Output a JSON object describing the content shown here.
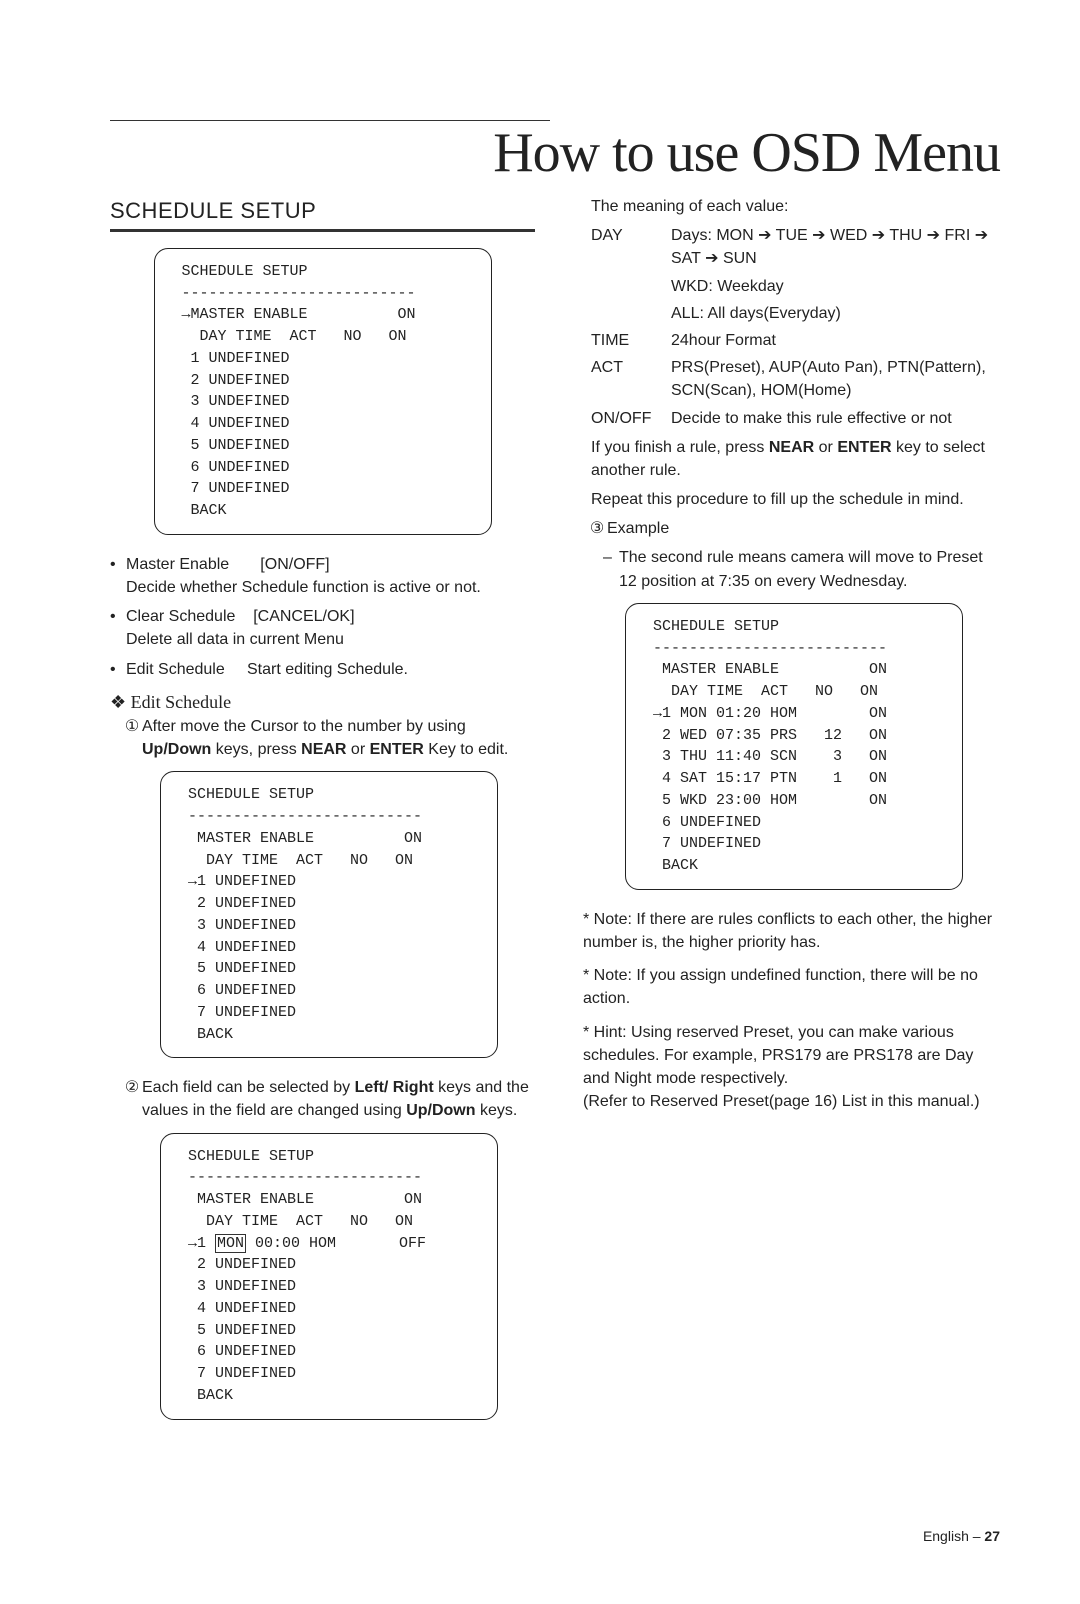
{
  "title": "How to use OSD Menu",
  "section_head": "SCHEDULE SETUP",
  "osd1": " SCHEDULE SETUP\n --------------------------\n →MASTER ENABLE          ON\n   DAY TIME  ACT   NO   ON\n  1 UNDEFINED\n  2 UNDEFINED\n  3 UNDEFINED\n  4 UNDEFINED\n  5 UNDEFINED\n  6 UNDEFINED\n  7 UNDEFINED\n  BACK",
  "b1_label": "Master Enable",
  "b1_opt": "[ON/OFF]",
  "b1_desc": "Decide whether Schedule function is active or not.",
  "b2_label": "Clear Schedule",
  "b2_opt": "[CANCEL/OK]",
  "b2_desc": "Delete all data in current Menu",
  "b3_label": "Edit Schedule",
  "b3_desc": "Start editing Schedule.",
  "edit_head": "❖ Edit Schedule",
  "step1_num": "①",
  "step1_a": "After move the Cursor to the number by using ",
  "step1_b": "Up/Down",
  "step1_c": " keys, press ",
  "step1_d": "NEAR",
  "step1_e": " or ",
  "step1_f": "ENTER",
  "step1_g": " Key to edit.",
  "osd2": " SCHEDULE SETUP\n --------------------------\n  MASTER ENABLE          ON\n   DAY TIME  ACT   NO   ON\n →1 UNDEFINED\n  2 UNDEFINED\n  3 UNDEFINED\n  4 UNDEFINED\n  5 UNDEFINED\n  6 UNDEFINED\n  7 UNDEFINED\n  BACK",
  "step2_num": "②",
  "step2_a": "Each field can be selected by ",
  "step2_b": "Left/ Right",
  "step2_c": " keys and the values in the field are changed using ",
  "step2_d": "Up/Down",
  "step2_e": " keys.",
  "osd3": " SCHEDULE SETUP\n --------------------------\n  MASTER ENABLE          ON\n   DAY TIME  ACT   NO   ON\n →1 MON 00:00 HOM       OFF\n  2 UNDEFINED\n  3 UNDEFINED\n  4 UNDEFINED\n  5 UNDEFINED\n  6 UNDEFINED\n  7 UNDEFINED\n  BACK",
  "right_intro": "The meaning of each value:",
  "kv_day_k": "DAY",
  "kv_day_v1": "Days: MON ➔ TUE ➔ WED ➔ THU ➔ FRI ➔ SAT ➔ SUN",
  "kv_day_v2": "WKD: Weekday",
  "kv_day_v3": "ALL: All days(Everyday)",
  "kv_time_k": "TIME",
  "kv_time_v": "24hour Format",
  "kv_act_k": "ACT",
  "kv_act_v": "PRS(Preset), AUP(Auto Pan), PTN(Pattern), SCN(Scan), HOM(Home)",
  "kv_onoff_k": "ON/OFF",
  "kv_onoff_v": "Decide to make this rule effective or not",
  "finish_a": "If you finish a rule, press ",
  "finish_b": "NEAR",
  "finish_c": " or ",
  "finish_d": "ENTER",
  "finish_e": " key to select another rule.",
  "repeat": "Repeat this procedure to fill up the schedule in mind.",
  "step3_num": "③",
  "step3_label": "Example",
  "example_desc": "The second rule means camera will move to Preset 12 position at 7:35 on every Wednesday.",
  "osd4": " SCHEDULE SETUP\n --------------------------\n  MASTER ENABLE          ON\n   DAY TIME  ACT   NO   ON\n →1 MON 01:20 HOM        ON\n  2 WED 07:35 PRS   12   ON\n  3 THU 11:40 SCN    3   ON\n  4 SAT 15:17 PTN    1   ON\n  5 WKD 23:00 HOM        ON\n  6 UNDEFINED\n  7 UNDEFINED\n  BACK",
  "note1": "* Note: If there are rules conflicts to each other, the higher number is, the higher priority has.",
  "note2": "* Note: If you assign undefined function, there will be no action.",
  "note3": "* Hint: Using reserved Preset, you can make various schedules. For example, PRS179 are PRS178 are Day and Night mode respectively.",
  "note3b": "(Refer to Reserved Preset(page 16) List in this manual.)",
  "footer_a": "English – ",
  "footer_b": "27"
}
